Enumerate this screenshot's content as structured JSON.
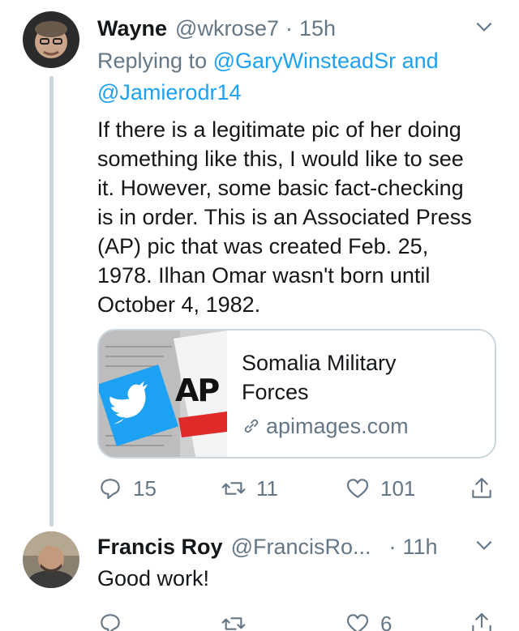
{
  "tweets": [
    {
      "name": "Wayne",
      "handle": "@wkrose7",
      "separator": "·",
      "time": "15h",
      "replying_prefix": "Replying to",
      "replying_user1": "@GaryWinsteadSr",
      "replying_and": "and",
      "replying_user2": "@Jamierodr14",
      "text": "If there is a legitimate pic of her doing\nsomething like this, I would like to see\nit. However, some basic fact-checking\nis in order. This is an Associated Press\n(AP) pic that was created  Feb. 25,\n1978. Ilhan Omar wasn't born until\nOctober 4, 1982.",
      "card": {
        "title_line1": "Somalia Military",
        "title_line2": "Forces",
        "domain": "apimages.com",
        "image_logo_text": "AP"
      },
      "actions": {
        "replies": "15",
        "retweets": "11",
        "likes": "101"
      }
    },
    {
      "name": "Francis Roy",
      "handle": "@FrancisRo...",
      "separator": "·",
      "time": "11h",
      "text": "Good work!",
      "actions": {
        "replies": "",
        "retweets": "",
        "likes": "6"
      }
    }
  ],
  "colors": {
    "link": "#1da1f2",
    "secondary": "#657786",
    "border": "#ccd6dd"
  }
}
